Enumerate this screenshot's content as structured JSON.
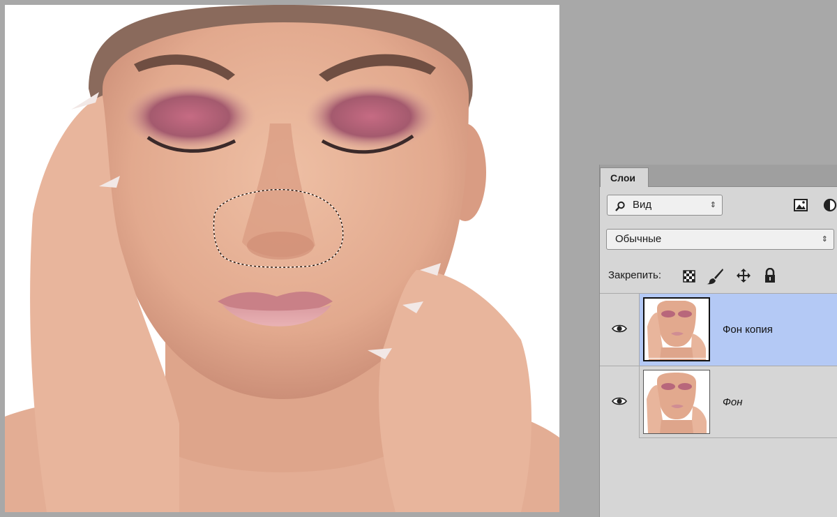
{
  "canvas": {
    "image_description": "photo"
  },
  "layers_panel": {
    "tab_label": "Слои",
    "filter": {
      "icon": "search-icon",
      "label": "Вид"
    },
    "filter_icons": [
      "image-filter-icon",
      "adjustment-filter-icon"
    ],
    "blend_mode": "Обычные",
    "lock": {
      "label": "Закрепить:",
      "icons": [
        "lock-transparent-pixels-icon",
        "lock-image-pixels-icon",
        "lock-position-icon",
        "lock-all-icon"
      ]
    },
    "layers": [
      {
        "name": "Фон копия",
        "visible": true,
        "selected": true
      },
      {
        "name": "Фон",
        "visible": true,
        "selected": false
      }
    ]
  },
  "colors": {
    "workspace": "#a8a8a8",
    "panel": "#d6d6d6",
    "selected_layer": "#b4c9f5"
  }
}
